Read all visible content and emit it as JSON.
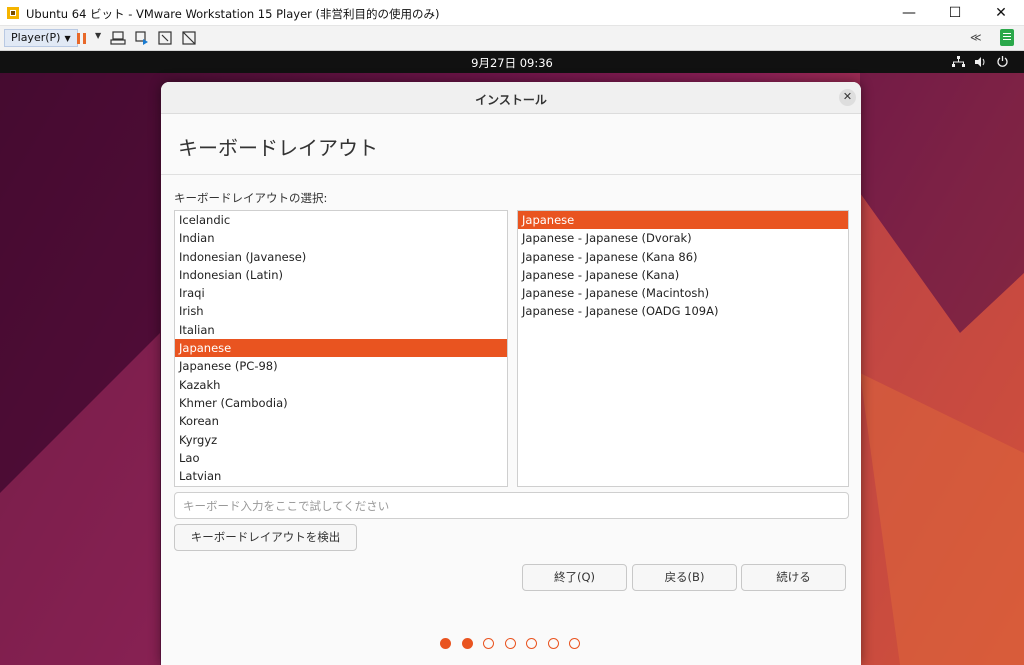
{
  "window": {
    "title": "Ubuntu 64 ビット - VMware Workstation 15 Player (非営利目的の使用のみ)",
    "minimize_icon": "minimize-icon",
    "maximize_icon": "maximize-icon",
    "close_icon": "close-icon"
  },
  "toolbar": {
    "player_label": "Player(P)",
    "icons": [
      "pause-icon",
      "send-ctrl-alt-del-icon",
      "removable-devices-icon",
      "fullscreen-icon",
      "unity-icon"
    ],
    "right_collapse": "≪",
    "right_icon": "vm-library-icon"
  },
  "ubuntu_topbar": {
    "clock": "9月27日  09:36",
    "tray_icons": [
      "network-icon",
      "volume-icon",
      "power-icon"
    ]
  },
  "installer": {
    "title": "インストール",
    "heading": "キーボードレイアウト",
    "select_label": "キーボードレイアウトの選択:",
    "layouts": [
      {
        "label": "Icelandic",
        "selected": false
      },
      {
        "label": "Indian",
        "selected": false
      },
      {
        "label": "Indonesian (Javanese)",
        "selected": false
      },
      {
        "label": "Indonesian (Latin)",
        "selected": false
      },
      {
        "label": "Iraqi",
        "selected": false
      },
      {
        "label": "Irish",
        "selected": false
      },
      {
        "label": "Italian",
        "selected": false
      },
      {
        "label": "Japanese",
        "selected": true
      },
      {
        "label": "Japanese (PC-98)",
        "selected": false
      },
      {
        "label": "Kazakh",
        "selected": false
      },
      {
        "label": "Khmer (Cambodia)",
        "selected": false
      },
      {
        "label": "Korean",
        "selected": false
      },
      {
        "label": "Kyrgyz",
        "selected": false
      },
      {
        "label": "Lao",
        "selected": false
      },
      {
        "label": "Latvian",
        "selected": false
      }
    ],
    "variants": [
      {
        "label": "Japanese",
        "selected": true
      },
      {
        "label": "Japanese - Japanese (Dvorak)",
        "selected": false
      },
      {
        "label": "Japanese - Japanese (Kana 86)",
        "selected": false
      },
      {
        "label": "Japanese - Japanese (Kana)",
        "selected": false
      },
      {
        "label": "Japanese - Japanese (Macintosh)",
        "selected": false
      },
      {
        "label": "Japanese - Japanese (OADG 109A)",
        "selected": false
      }
    ],
    "test_input": {
      "value": "",
      "placeholder": "キーボード入力をここで試してください"
    },
    "detect_button": "キーボードレイアウトを検出",
    "quit_button": "終了(Q)",
    "back_button": "戻る(B)",
    "continue_button": "続ける",
    "progress": {
      "total_steps": 7,
      "completed_steps": 2
    },
    "accent_color": "#e95420"
  }
}
